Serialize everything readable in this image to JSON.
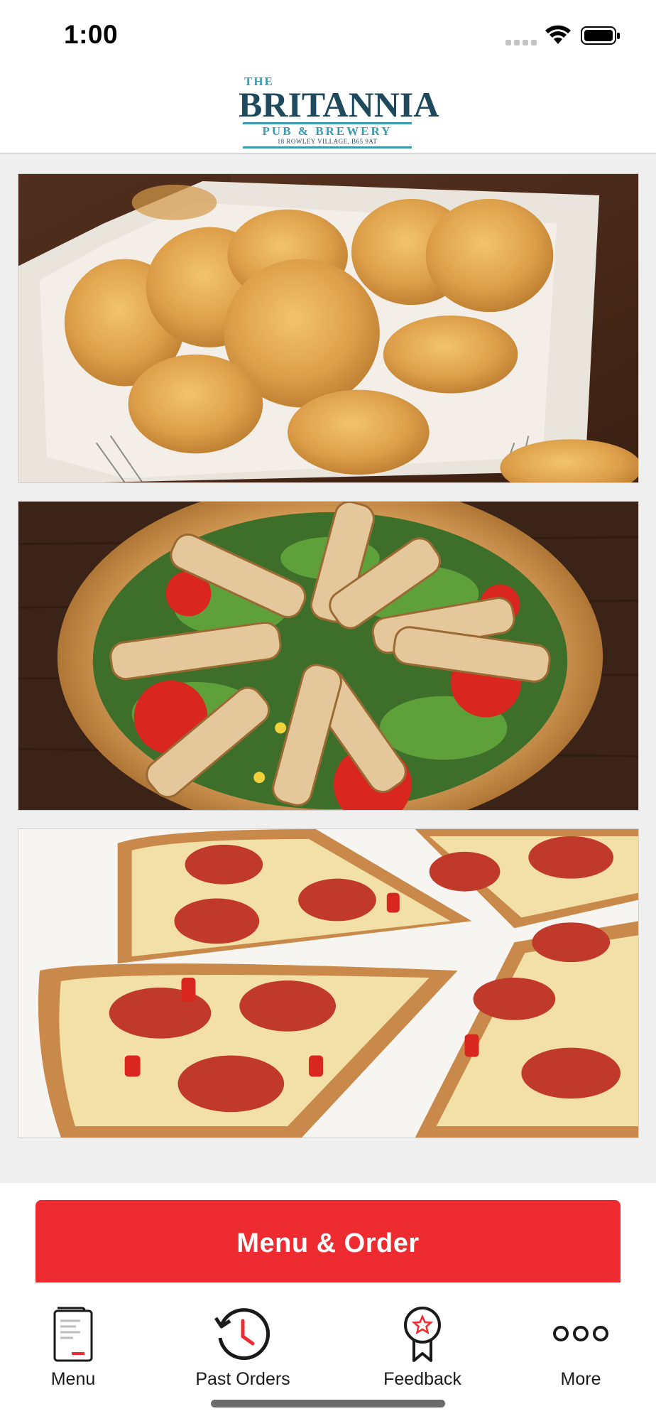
{
  "status_bar": {
    "time": "1:00"
  },
  "header": {
    "logo_text": {
      "the": "THE",
      "name": "BRITANNIA",
      "subtitle": "PUB & BREWERY",
      "address": "18 ROWLEY VILLAGE, B65 9AT"
    }
  },
  "feature_images": [
    {
      "name": "chicken nuggets"
    },
    {
      "name": "grilled chicken salad"
    },
    {
      "name": "pepperoni pizza"
    }
  ],
  "order_button": {
    "label": "Menu & Order"
  },
  "tab_bar": {
    "items": [
      {
        "label": "Menu",
        "icon": "menu-book-icon"
      },
      {
        "label": "Past Orders",
        "icon": "history-clock-icon"
      },
      {
        "label": "Feedback",
        "icon": "award-ribbon-icon"
      },
      {
        "label": "More",
        "icon": "more-dots-icon"
      }
    ]
  },
  "colors": {
    "accent": "#ee2b31",
    "brand_dark": "#1f4a5e",
    "brand_light": "#3a9ab0"
  }
}
